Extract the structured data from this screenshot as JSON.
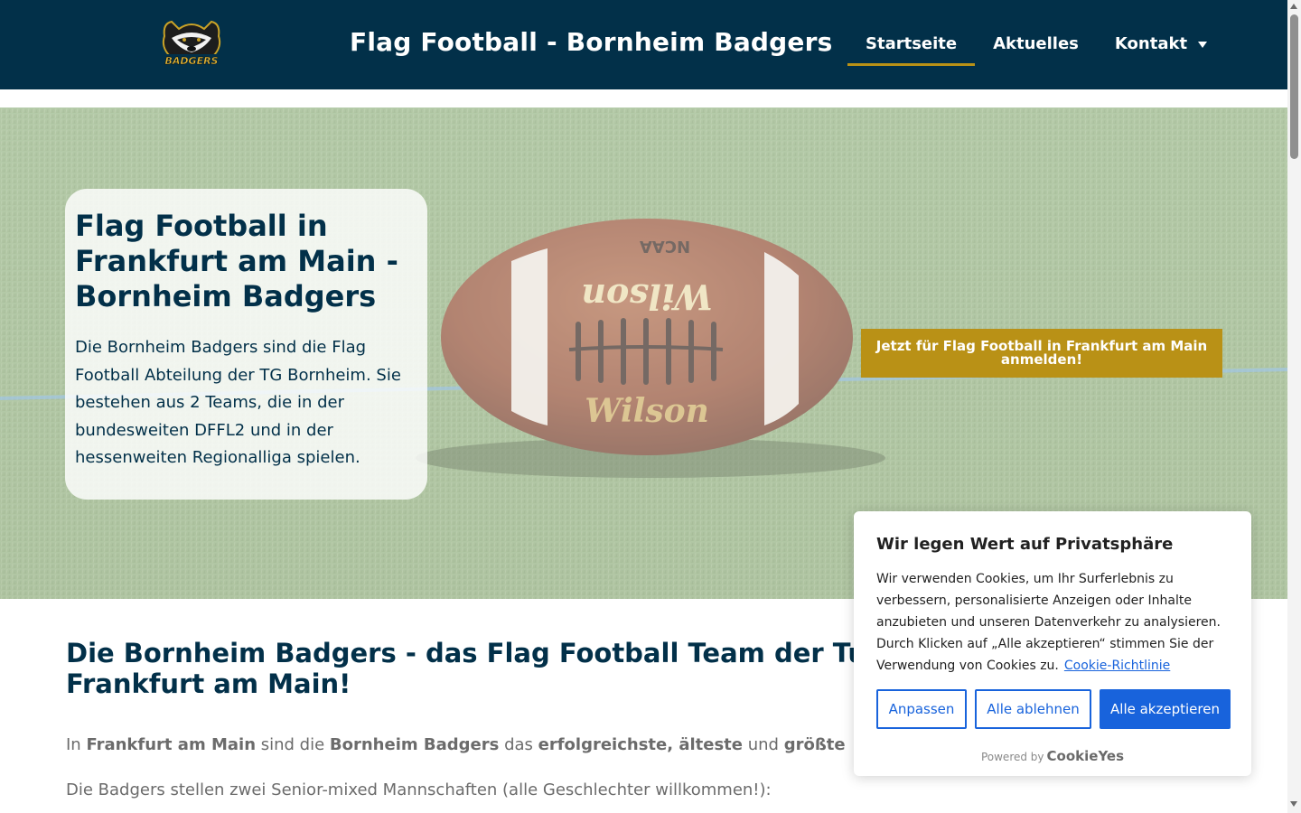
{
  "header": {
    "logo_text": "BADGERS",
    "site_title": "Flag Football - Bornheim Badgers",
    "nav": [
      {
        "label": "Startseite",
        "active": true
      },
      {
        "label": "Aktuelles",
        "active": false
      },
      {
        "label": "Kontakt",
        "active": false,
        "has_dropdown": true
      }
    ]
  },
  "hero": {
    "title": "Flag Football in Frankfurt am Main - Bornheim Badgers",
    "text": "Die Bornheim Badgers sind die Flag Football Abteilung der TG Bornheim. Sie bestehen aus 2 Teams, die in der bundesweiten DFFL2 und in der hessenweiten Regionalliga spielen.",
    "cta_label": "Jetzt für Flag Football in Frankfurt am Main anmelden!",
    "ball_brand": "Wilson",
    "ball_mark": "NCAA"
  },
  "main": {
    "heading": "Die Bornheim Badgers - das Flag Football Team der Turngemeinde Bornheim in Frankfurt am Main!",
    "intro": {
      "t1": "In ",
      "b1": "Frankfurt am Main",
      "t2": " sind die ",
      "b2": "Bornheim Badgers",
      "t3": " das ",
      "b3": "erfolgreichste, älteste",
      "t4": " und ",
      "b4": "größte"
    },
    "teams_text": "Die Badgers stellen zwei Senior-mixed Mannschaften (alle Geschlechter willkommen!):"
  },
  "cookie": {
    "title": "Wir legen Wert auf Privatsphäre",
    "text": "Wir verwenden Cookies, um Ihr Surferlebnis zu verbessern, personalisierte Anzeigen oder Inhalte anzubieten und unseren Datenverkehr zu analysieren. Durch Klicken auf „Alle akzeptieren“ stimmen Sie der Verwendung von Cookies zu.",
    "policy_link": "Cookie-Richtlinie",
    "customize": "Anpassen",
    "reject": "Alle ablehnen",
    "accept": "Alle akzeptieren",
    "powered_by": "Powered by",
    "powered_brand": "CookieYes"
  },
  "colors": {
    "navy": "#023049",
    "gold": "#b99116",
    "cookie_blue": "#1863dc"
  }
}
